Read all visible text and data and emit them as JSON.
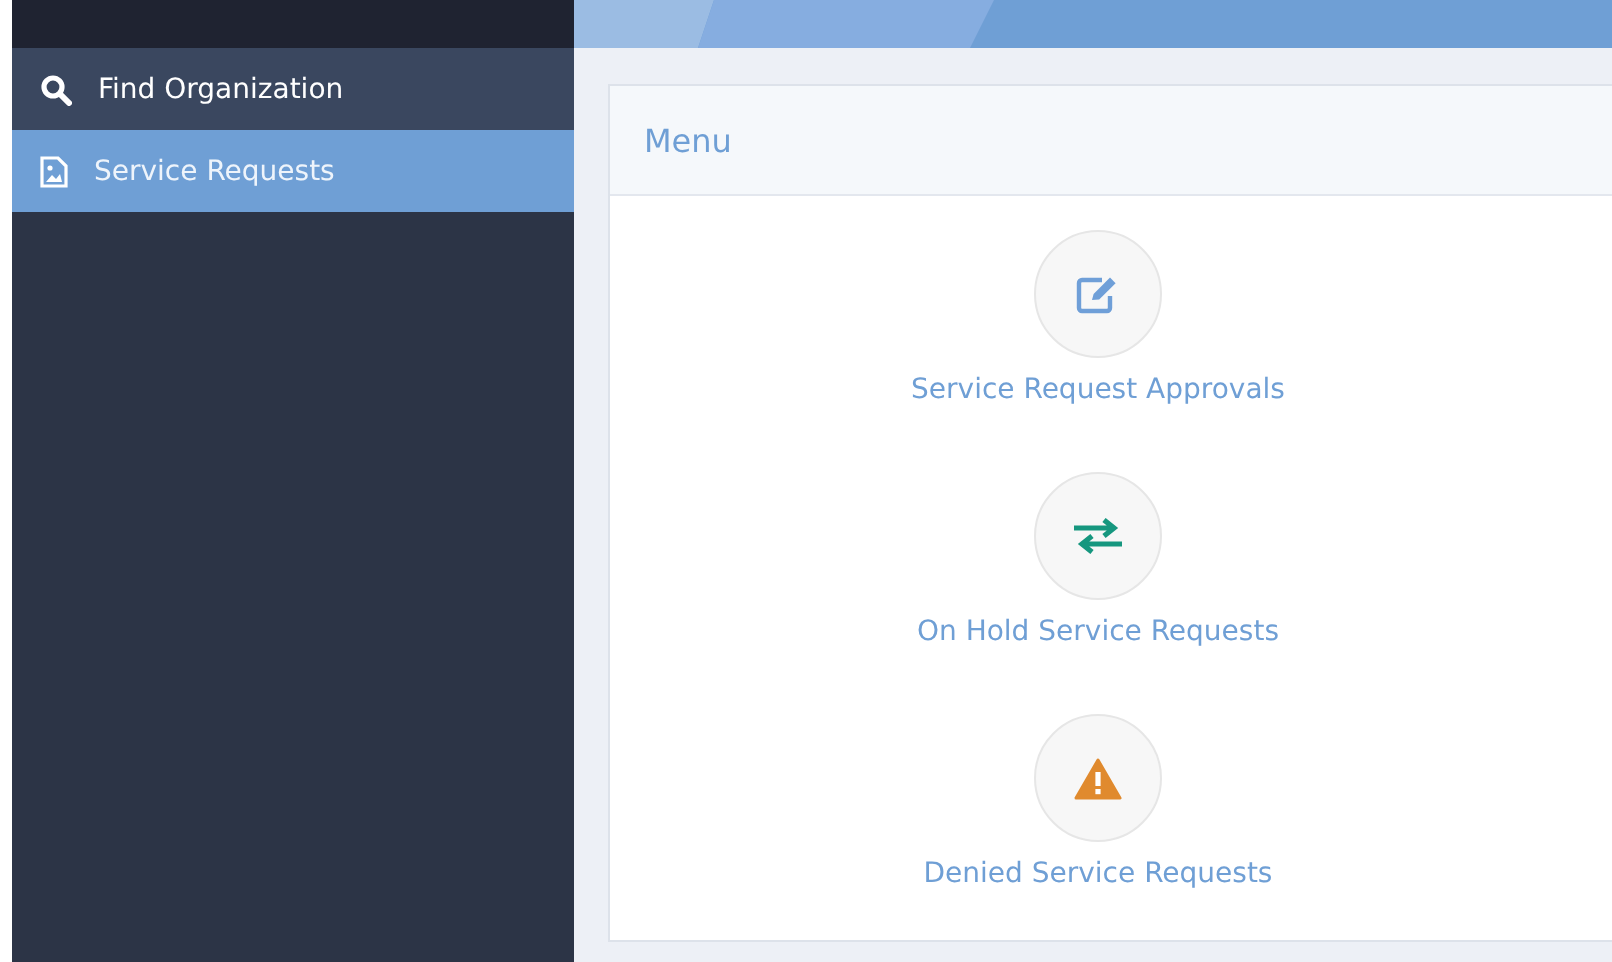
{
  "sidebar": {
    "items": [
      {
        "label": "Find Organization",
        "kind": "search",
        "selected": false
      },
      {
        "label": "Service Requests",
        "kind": "document",
        "selected": true
      }
    ]
  },
  "panel": {
    "title": "Menu",
    "items": [
      {
        "label": "Service Request Approvals",
        "kind": "edit"
      },
      {
        "label": "On Hold Service Requests",
        "kind": "transfer"
      },
      {
        "label": "Denied Service Requests",
        "kind": "warning"
      }
    ]
  }
}
